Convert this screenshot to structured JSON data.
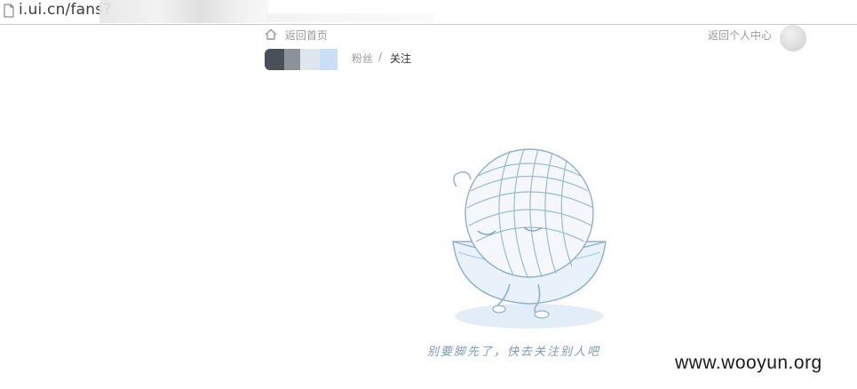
{
  "browser": {
    "url_text": "i.ui.cn/fans?"
  },
  "nav": {
    "back_home": "返回首页",
    "back_personal_center": "返回个人中心"
  },
  "breadcrumb": {
    "fans": "粉丝",
    "separator": "/",
    "follow": "关注"
  },
  "empty_state": {
    "message": "别要脚先了，快去关注别人吧",
    "illustration": "yarn-ball-character-icon"
  },
  "watermark": {
    "text": "www.wooyun.org"
  },
  "colors": {
    "nav_text": "#999999",
    "breadcrumb_active": "#333333",
    "illustration_line": "#8fb0cc",
    "illustration_fill": "#e6f0fa"
  }
}
